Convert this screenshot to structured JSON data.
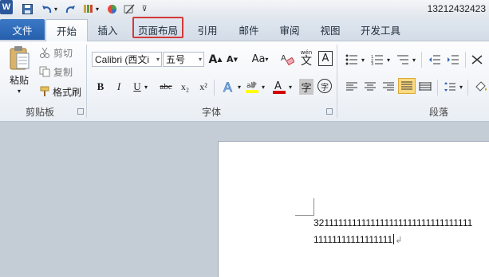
{
  "titlebar": {
    "logo": "W",
    "user_id": "13212432423"
  },
  "tabs": [
    "文件",
    "开始",
    "插入",
    "页面布局",
    "引用",
    "邮件",
    "审阅",
    "视图",
    "开发工具"
  ],
  "clipboard": {
    "paste": "粘贴",
    "cut": "剪切",
    "copy": "复制",
    "format_painter": "格式刷",
    "group": "剪贴板"
  },
  "font": {
    "name": "Calibri (西文i",
    "size": "五号",
    "group": "字体",
    "bold": "B",
    "italic": "I",
    "underline": "U",
    "strike": "abc",
    "subscript": "x₂",
    "superscript": "x²",
    "grow": "A",
    "shrink": "A",
    "change_case": "Aa",
    "pinyin": "wén",
    "char_border": "A",
    "char_shade": "字",
    "enclose": "字"
  },
  "paragraph": {
    "group": "段落"
  },
  "document": {
    "line1": "3211111111111111111111111111111111",
    "line2": "11111111111111111",
    "para_mark": "↲"
  },
  "colors": {
    "file_tab": "#2b5fab",
    "highlight_box": "#d23a3a",
    "font_color": "#d40000",
    "highlight_color": "#ffff00"
  }
}
